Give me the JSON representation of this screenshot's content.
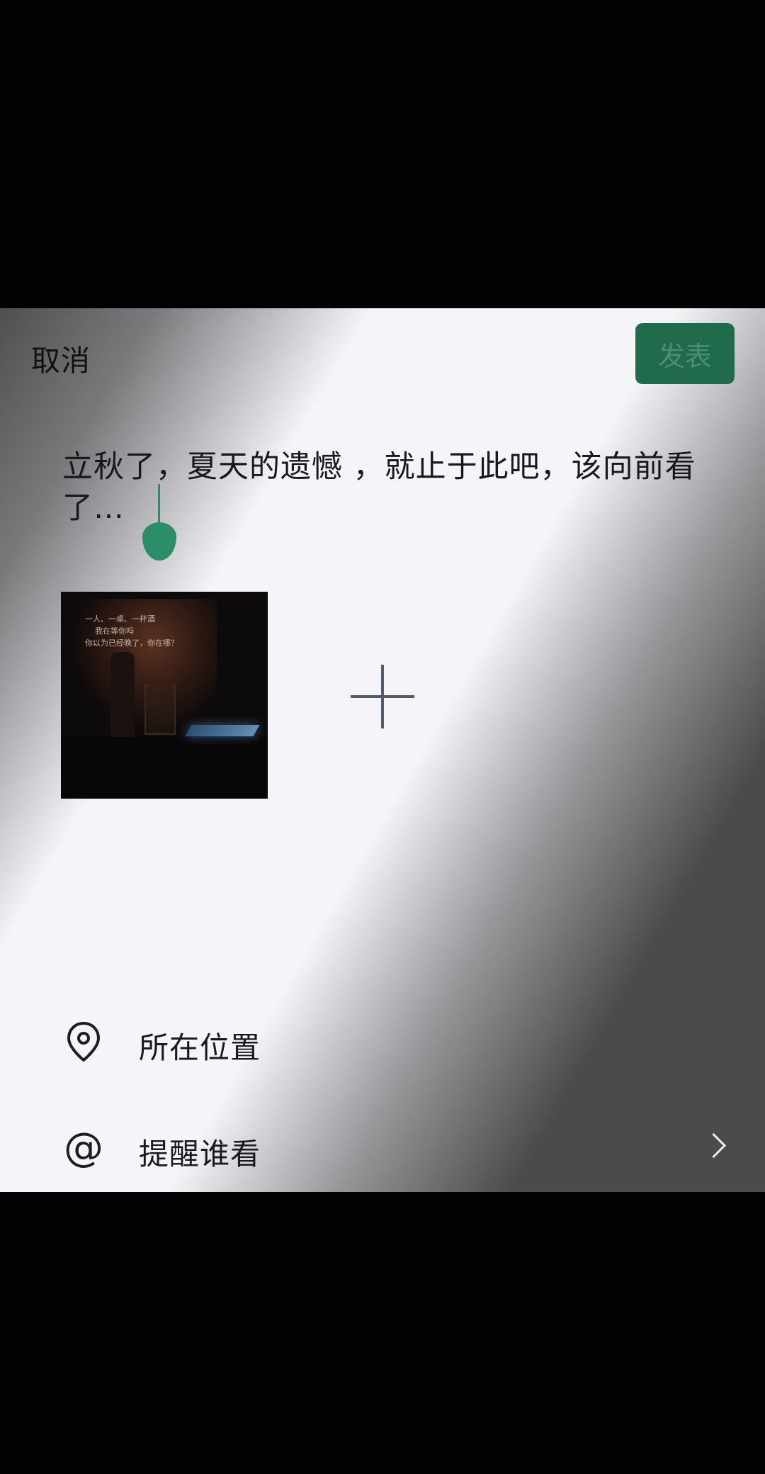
{
  "header": {
    "cancel_label": "取消",
    "publish_label": "发表"
  },
  "post": {
    "text": "立秋了，夏天的遗憾 ，就止于此吧，该向前看了…"
  },
  "photo": {
    "overlay_lines": [
      "一人、一桌、一杯酒",
      "我在等你吗",
      "你以为已经晚了，你在哪？"
    ]
  },
  "options": {
    "location_label": "所在位置",
    "mention_label": "提醒谁看",
    "mention_icon": "@"
  },
  "colors": {
    "accent_green": "#2a8e68",
    "publish_bg": "#1f6b4b"
  },
  "icons": {
    "location": "location-pin-icon",
    "mention": "at-sign-icon",
    "add": "plus-icon",
    "chevron": "chevron-right-icon"
  }
}
